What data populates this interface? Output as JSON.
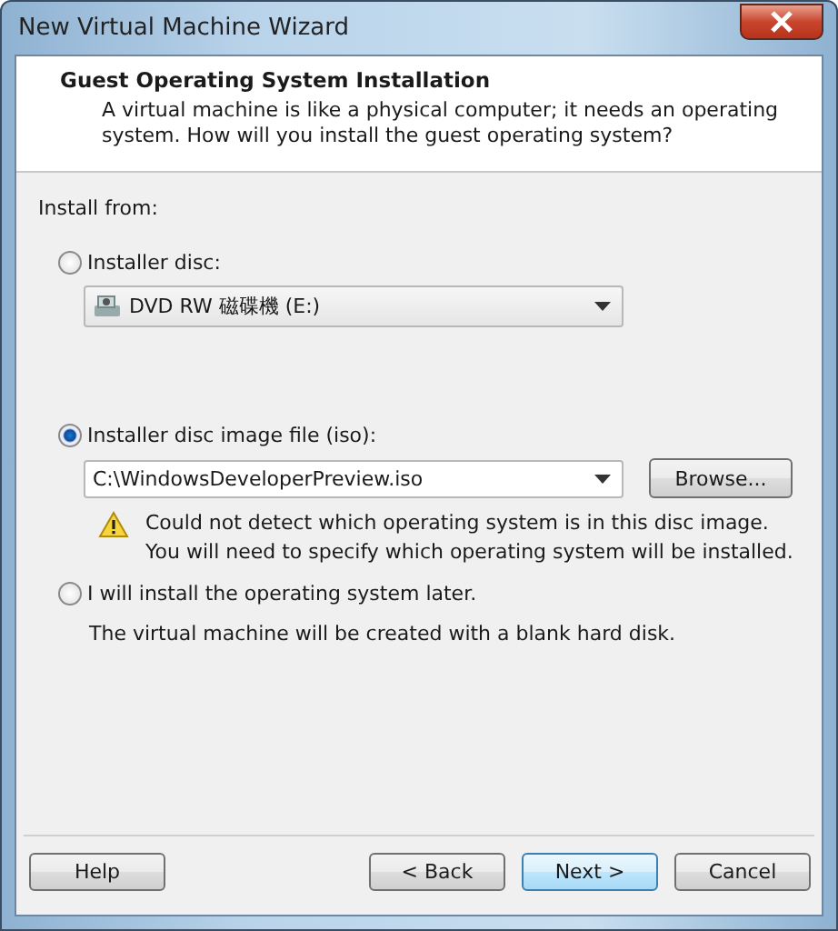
{
  "window": {
    "title": "New Virtual Machine Wizard"
  },
  "header": {
    "title": "Guest Operating System Installation",
    "description": "A virtual machine is like a physical computer; it needs an operating system. How will you install the guest operating system?"
  },
  "section_label": "Install from:",
  "options": [
    {
      "kind": "disc",
      "label": "Installer disc:",
      "selected": false,
      "dropdown": {
        "value": "DVD RW 磁碟機 (E:)"
      }
    },
    {
      "kind": "iso",
      "label": "Installer disc image file (iso):",
      "selected": true,
      "combobox": {
        "value": "C:\\WindowsDeveloperPreview.iso"
      },
      "browse_button": "Browse...",
      "warning": [
        "Could not detect which operating system is in this disc image.",
        "You will need to specify which operating system will be installed."
      ]
    },
    {
      "kind": "later",
      "label": "I will install the operating system later.",
      "selected": false,
      "note": "The virtual machine will be created with a blank hard disk."
    }
  ],
  "buttons": [
    {
      "label": "Help",
      "default": false
    },
    {
      "label": "< Back",
      "default": false
    },
    {
      "label": "Next >",
      "default": true
    },
    {
      "label": "Cancel",
      "default": false
    }
  ]
}
